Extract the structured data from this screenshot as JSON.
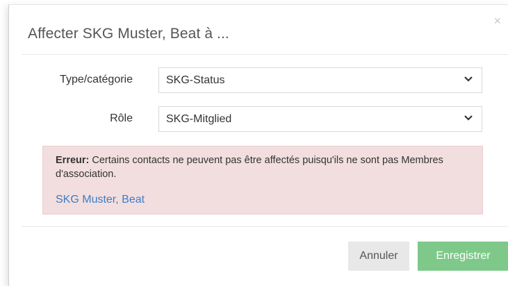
{
  "dialog": {
    "title": "Affecter SKG Muster, Beat à ...",
    "close_glyph": "×"
  },
  "form": {
    "type_label": "Type/catégorie",
    "type_value": "SKG-Status",
    "role_label": "Rôle",
    "role_value": "SKG-Mitglied"
  },
  "alert": {
    "prefix": "Erreur:",
    "message": " Certains contacts ne peuvent pas être affectés puisqu'ils ne sont pas Membres d'association.",
    "contact_link": "SKG Muster, Beat",
    "bg_color": "#f2dede"
  },
  "footer": {
    "cancel_label": "Annuler",
    "save_label": "Enregistrer",
    "save_color": "#7ec98a"
  },
  "icons": {
    "close": "close-icon",
    "dropdown": "chevron-down-icon"
  }
}
